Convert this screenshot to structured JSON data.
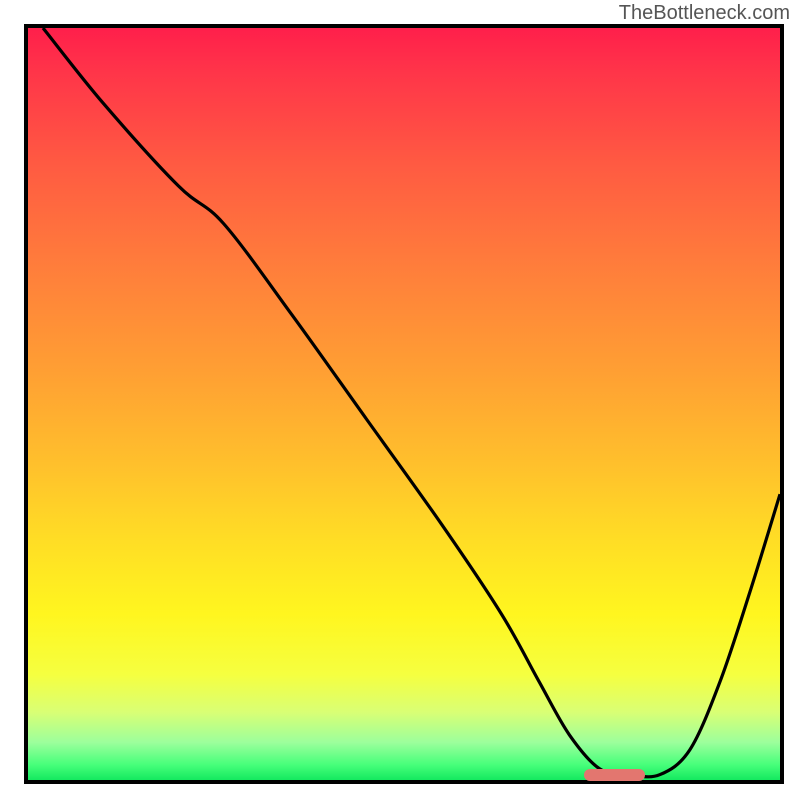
{
  "branding": {
    "text": "TheBottleneck.com"
  },
  "colors": {
    "gradient_top": "#ff1f4b",
    "gradient_bottom": "#14e95f",
    "curve": "#000000",
    "marker": "#e3766f",
    "border": "#000000"
  },
  "chart_data": {
    "type": "line",
    "title": "",
    "xlabel": "",
    "ylabel": "",
    "xlim": [
      0,
      100
    ],
    "ylim": [
      0,
      100
    ],
    "grid": false,
    "annotations": [],
    "series": [
      {
        "name": "curve",
        "x": [
          2,
          10,
          20,
          26,
          35,
          45,
          55,
          63,
          68,
          72,
          76,
          80,
          84,
          88,
          92,
          96,
          100
        ],
        "y": [
          100,
          90,
          79,
          74,
          62,
          48,
          34,
          22,
          13,
          6,
          1.5,
          0.7,
          0.7,
          4,
          13,
          25,
          38
        ]
      }
    ],
    "optimal_marker": {
      "x_start": 74,
      "x_end": 82,
      "y": 0.6
    }
  }
}
